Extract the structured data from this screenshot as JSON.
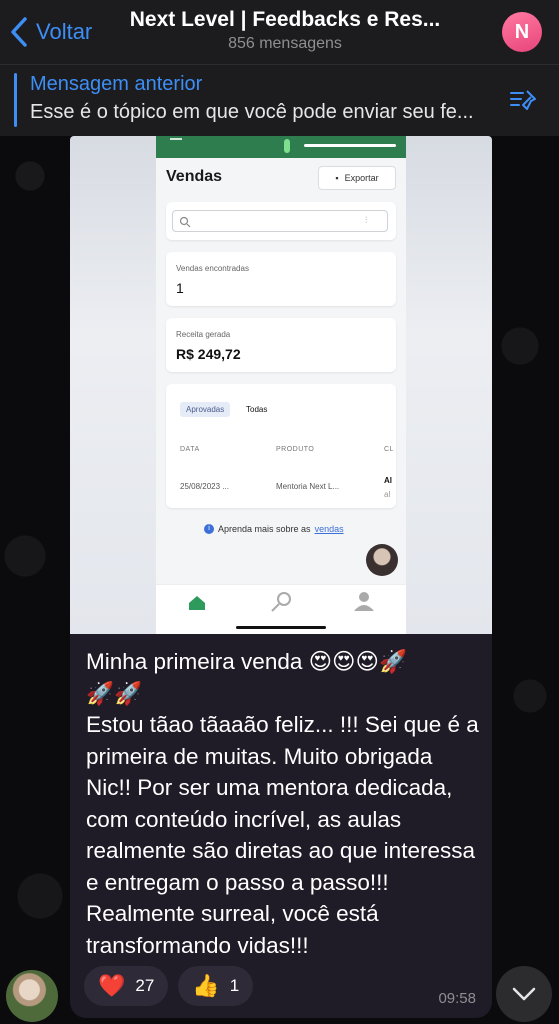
{
  "header": {
    "back_label": "Voltar",
    "title": "Next Level | Feedbacks e Res...",
    "subtitle": "856 mensagens",
    "avatar_letter": "N"
  },
  "pinned": {
    "title": "Mensagem anterior",
    "text": "Esse é o tópico em que você pode enviar seu fe..."
  },
  "screenshot": {
    "page_title": "Vendas",
    "export_label": "Exportar",
    "found_label": "Vendas encontradas",
    "found_value": "1",
    "revenue_label": "Receita gerada",
    "revenue_value": "R$ 249,72",
    "tabs": [
      "Aprovadas",
      "Todas"
    ],
    "columns": [
      "DATA",
      "PRODUTO",
      "CL"
    ],
    "row": {
      "date": "25/08/2023 ...",
      "product": "Mentoria Next L...",
      "client": "Al",
      "client_sub": "al"
    },
    "learn_text": "Aprenda mais sobre as",
    "learn_link": "vendas"
  },
  "message": {
    "text": "Minha primeira venda 😍😍😍🚀\n🚀🚀\nEstou tãao tãaaão feliz... !!! Sei que é a primeira de muitas. Muito obrigada Nic!! Por ser uma mentora dedicada, com conteúdo incrível, as aulas realmente são diretas ao que interessa e entregam o passo a passo!!! Realmente surreal, você está transformando vidas!!!",
    "time": "09:58"
  },
  "reactions": [
    {
      "emoji": "❤️",
      "count": "27"
    },
    {
      "emoji": "👍",
      "count": "1"
    }
  ],
  "colors": {
    "accent": "#3d8ef5",
    "bubble": "#1f1b27",
    "header": "#1c1c1e"
  }
}
